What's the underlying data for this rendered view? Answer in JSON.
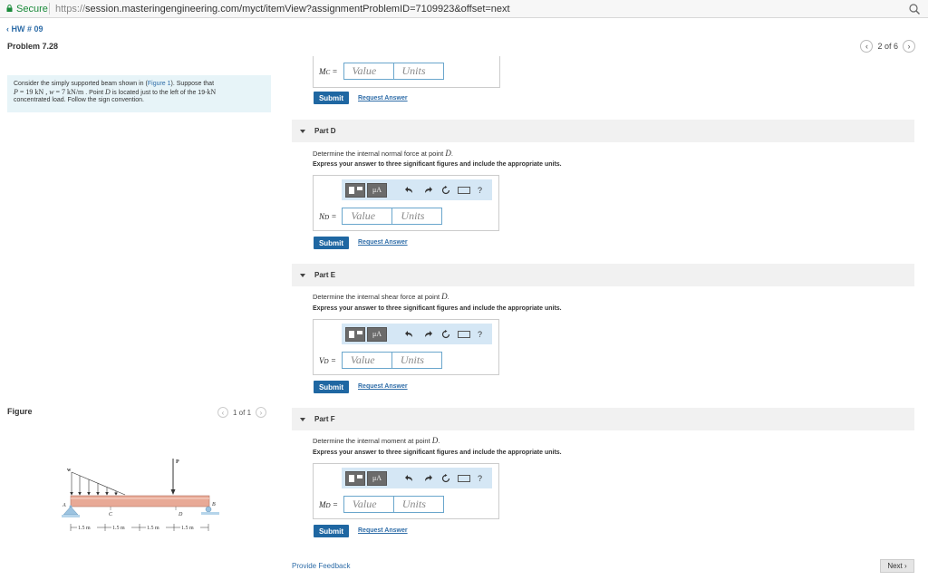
{
  "browser": {
    "secure_label": "Secure",
    "url_scheme": "https://",
    "url_rest": "session.masteringengineering.com/myct/itemView?assignmentProblemID=7109923&offset=next"
  },
  "header": {
    "back_label": "HW # 09",
    "problem_title": "Problem 7.28",
    "pager_text": "2 of 6"
  },
  "problem": {
    "intro_a": "Consider the simply supported beam shown in (",
    "figure_link": "Figure 1",
    "intro_b": "). Suppose that",
    "P_sym": "P",
    "P_val": " = 19 ",
    "P_unit": "kN",
    "w_sym": " , w",
    "w_val": " = 7 ",
    "w_unit": "kN/m",
    "D_a": " . Point ",
    "D_sym": "D",
    "D_b": " is located just to the left of the 19-",
    "D_unit": "kN",
    "line3": "concentrated load. Follow the sign convention."
  },
  "figure": {
    "label": "Figure",
    "pager": "1 of 1",
    "labels": {
      "w": "w",
      "P": "P",
      "A": "A",
      "B": "B",
      "C": "C",
      "D": "D"
    },
    "dims": [
      "1.5 m",
      "1.5 m",
      "1.5 m",
      "1.5 m"
    ]
  },
  "common": {
    "value_placeholder": "Value",
    "units_placeholder": "Units",
    "submit": "Submit",
    "request": "Request Answer",
    "instructions": "Express your answer to three significant figures and include the appropriate units.",
    "mu_label": "μA",
    "help": "?"
  },
  "partC": {
    "var": "M",
    "sub": "C",
    "eq": " ="
  },
  "partD": {
    "title": "Part D",
    "question": "Determine the internal normal force at point ",
    "point": "D",
    "period": ".",
    "var": "N",
    "sub": "D",
    "eq": " ="
  },
  "partE": {
    "title": "Part E",
    "question": "Determine the internal shear force at point ",
    "point": "D",
    "period": ".",
    "var": "V",
    "sub": "D",
    "eq": " ="
  },
  "partF": {
    "title": "Part F",
    "question": "Determine the internal moment at point ",
    "point": "D",
    "period": ".",
    "var": "M",
    "sub": "D",
    "eq": " ="
  },
  "footer": {
    "feedback": "Provide Feedback",
    "next": "Next"
  }
}
